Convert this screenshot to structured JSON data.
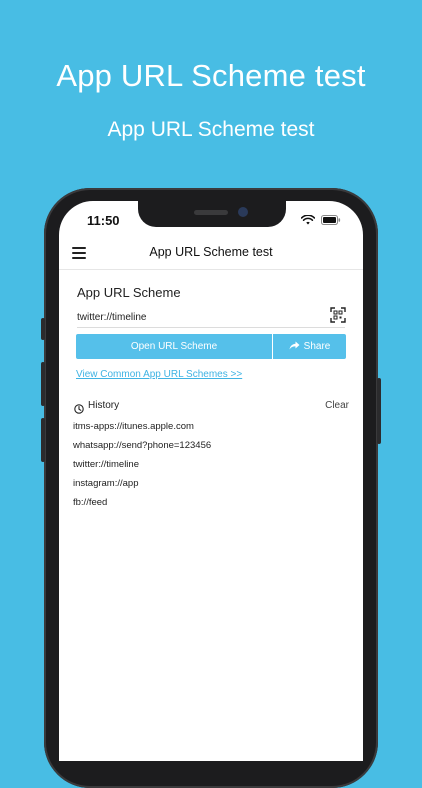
{
  "promo": {
    "title": "App URL Scheme test",
    "subtitle": "App URL Scheme test"
  },
  "status_bar": {
    "time": "11:50",
    "icons": [
      "wifi-icon",
      "battery-icon"
    ]
  },
  "nav": {
    "title": "App URL Scheme test",
    "menu_icon": "menu-icon"
  },
  "scheme": {
    "section_title": "App URL Scheme",
    "input_value": "twitter://timeline",
    "scan_icon": "qr-scan-icon",
    "open_button": "Open URL Scheme",
    "share_button": "Share",
    "common_link": "View Common App URL Schemes >>"
  },
  "history": {
    "label": "History",
    "clear_label": "Clear",
    "items": [
      "itms-apps://itunes.apple.com",
      "whatsapp://send?phone=123456",
      "twitter://timeline",
      "instagram://app",
      "fb://feed"
    ]
  },
  "colors": {
    "background": "#48bde4",
    "accent": "#55c0ea",
    "link": "#3fb3e3"
  }
}
